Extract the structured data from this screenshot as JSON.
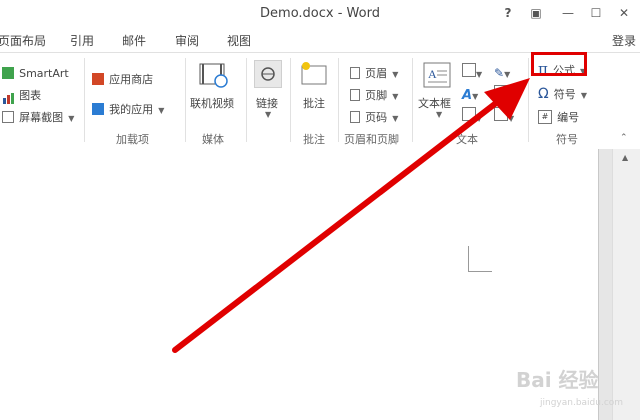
{
  "window": {
    "title": "Demo.docx - Word",
    "help": "?",
    "ribbon_options": "▣",
    "minimize": "—",
    "restore": "☐",
    "close": "✕"
  },
  "menu": {
    "tabs": [
      "页面布局",
      "引用",
      "邮件",
      "审阅",
      "视图"
    ],
    "signin": "登录"
  },
  "ribbon": {
    "illustrations": {
      "smartart": "SmartArt",
      "chart": "图表",
      "screenshot": "屏幕截图"
    },
    "addins": {
      "store": "应用商店",
      "my_apps": "我的应用",
      "group": "加载项"
    },
    "media": {
      "online_video": "联机视频",
      "group": "媒体"
    },
    "links": {
      "link": "链接"
    },
    "comments": {
      "comment": "批注",
      "group": "批注"
    },
    "header_footer": {
      "header": "页眉",
      "footer": "页脚",
      "page_number": "页码",
      "group": "页眉和页脚"
    },
    "text": {
      "textbox": "文本框",
      "group": "文本"
    },
    "symbols": {
      "equation": "公式",
      "symbol": "符号",
      "numbering": "编号",
      "group": "符号"
    }
  },
  "watermark": {
    "brand": "Bai 经验",
    "url": "jingyan.baidu.com"
  },
  "colors": {
    "highlight": "#e00000",
    "arrow": "#e00000",
    "accent_blue": "#2b579a"
  }
}
